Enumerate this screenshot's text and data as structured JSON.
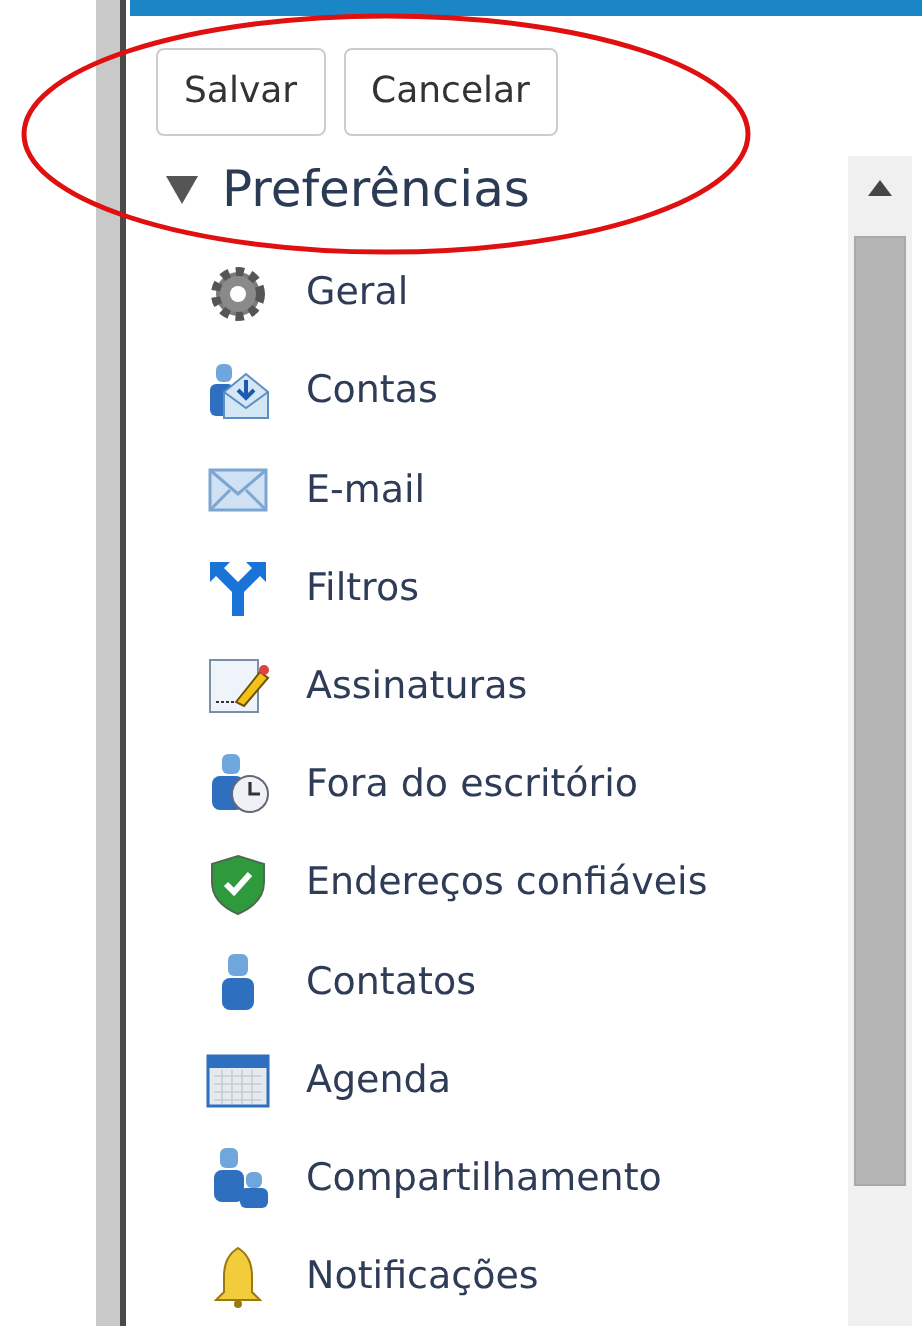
{
  "toolbar": {
    "buttons": [
      {
        "label": "Salvar"
      },
      {
        "label": "Cancelar"
      }
    ]
  },
  "tree": {
    "label": "Preferências",
    "expanded": true,
    "children": [
      {
        "label": "Geral"
      },
      {
        "label": "Contas"
      },
      {
        "label": "E-mail"
      },
      {
        "label": "Filtros"
      },
      {
        "label": "Assinaturas"
      },
      {
        "label": "Fora do escritório"
      },
      {
        "label": "Endereços confiáveis"
      },
      {
        "label": "Contatos"
      },
      {
        "label": "Agenda"
      },
      {
        "label": "Compartilhamento"
      },
      {
        "label": "Notificações"
      }
    ]
  }
}
